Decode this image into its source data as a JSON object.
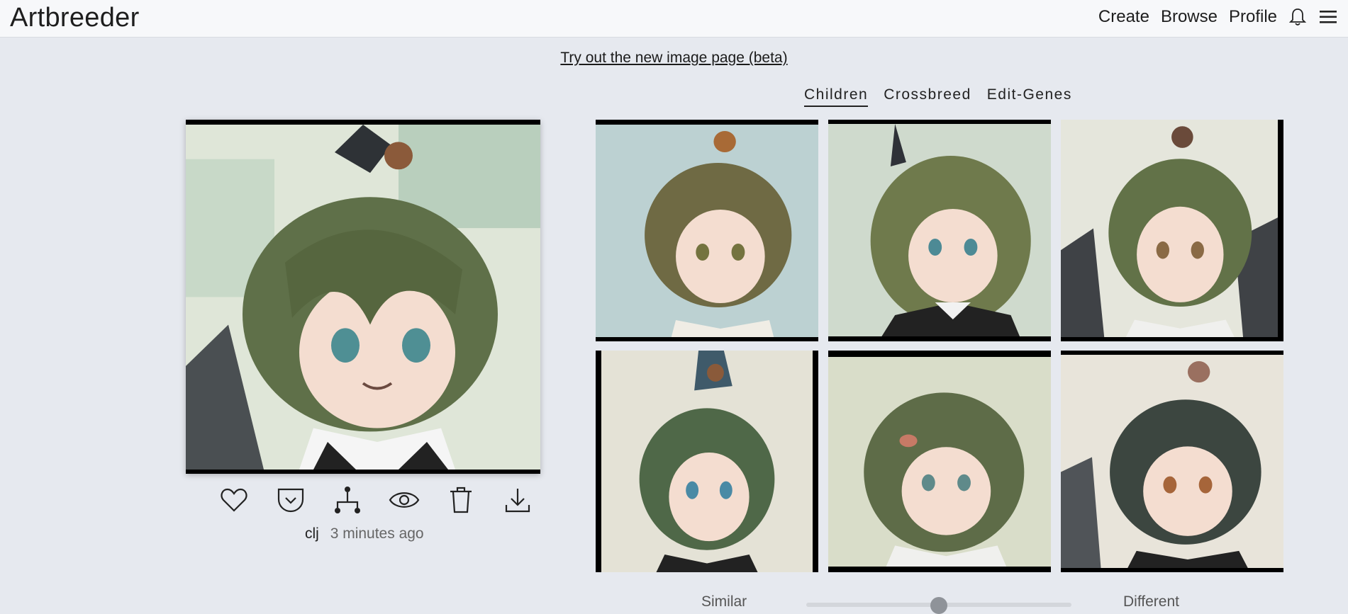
{
  "header": {
    "logo": "Artbreeder",
    "nav": {
      "create": "Create",
      "browse": "Browse",
      "profile": "Profile"
    }
  },
  "beta_link": "Try out the new image page (beta)",
  "tabs": [
    "Children",
    "Crossbreed",
    "Edit-Genes"
  ],
  "active_tab": "Children",
  "main_image": {
    "user": "clj",
    "time": "3 minutes ago",
    "actions": [
      "heart-icon",
      "save-icon",
      "family-tree-icon",
      "eye-icon",
      "trash-icon",
      "download-icon"
    ]
  },
  "children_count": 6,
  "slider": {
    "left_label": "Similar",
    "right_label": "Different",
    "value": 0.5
  },
  "colors": {
    "background": "#e6e9ef",
    "header": "#f7f8fa",
    "hair_green": "#5f7049",
    "skin": "#f4ddd0"
  }
}
